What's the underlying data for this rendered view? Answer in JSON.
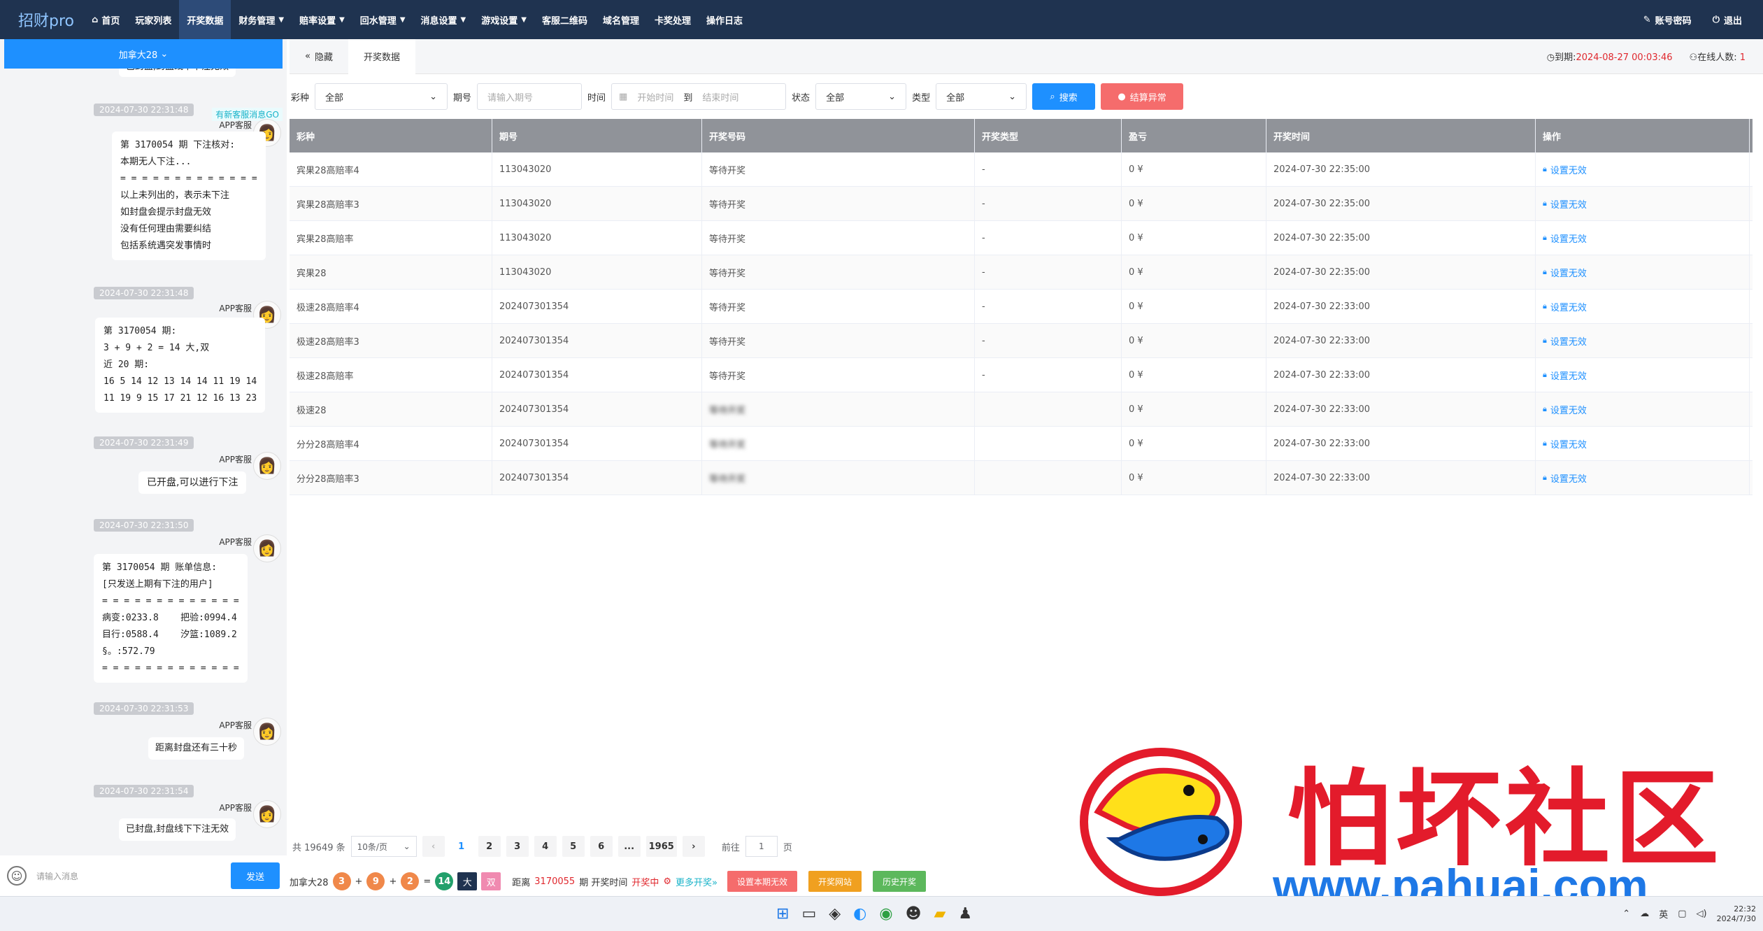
{
  "app": {
    "logo": "招财pro"
  },
  "nav": {
    "items": [
      {
        "label": "首页",
        "icon": "home-icon"
      },
      {
        "label": "玩家列表"
      },
      {
        "label": "开奖数据",
        "active": true
      },
      {
        "label": "财务管理",
        "dropdown": true
      },
      {
        "label": "赔率设置",
        "dropdown": true
      },
      {
        "label": "回水管理",
        "dropdown": true
      },
      {
        "label": "消息设置",
        "dropdown": true
      },
      {
        "label": "游戏设置",
        "dropdown": true
      },
      {
        "label": "客服二维码"
      },
      {
        "label": "域名管理"
      },
      {
        "label": "卡奖处理"
      },
      {
        "label": "操作日志"
      }
    ],
    "account_password": "账号密码",
    "logout": "退出"
  },
  "chat": {
    "header": "加拿大28",
    "top_partial": "已封盘,封盘线下下注无效",
    "notice": "有新客服消息GO",
    "messages": [
      {
        "time": "2024-07-30 22:31:48",
        "sender": "APP客服",
        "text": "第 3170054 期 下注核对:\n本期无人下注...\n= = = = = = = = = = = = =\n以上未列出的，表示未下注\n如封盘会提示封盘无效\n没有任何理由需要纠结\n包括系统遇突发事情时"
      },
      {
        "time": "2024-07-30 22:31:48",
        "sender": "APP客服",
        "text": "第 3170054 期:\n3 + 9 + 2 = 14 大,双\n近 20 期:\n16 5 14 12 13 14 14 11 19 14\n11 19 9 15 17 21 12 16 13 23"
      },
      {
        "time": "2024-07-30 22:31:49",
        "sender": "APP客服",
        "text": "已开盘,可以进行下注"
      },
      {
        "time": "2024-07-30 22:31:50",
        "sender": "APP客服",
        "text": "第 3170054 期 账单信息:\n[只发送上期有下注的用户]\n= = = = = = = = = = = = =\n病变:0233.8    把验:0994.4\n目行:0588.4    汐篮:1089.2\n§。:572.79\n= = = = = = = = = = = = ="
      },
      {
        "time": "2024-07-30 22:31:53",
        "sender": "APP客服",
        "text": "距离封盘还有三十秒"
      },
      {
        "time": "2024-07-30 22:31:54",
        "sender": "APP客服",
        "text": "已封盘,封盘线下下注无效"
      }
    ],
    "input_placeholder": "请输入消息",
    "send": "发送"
  },
  "tabs": {
    "hide": "隐藏",
    "current": "开奖数据"
  },
  "info": {
    "expiry_label": "到期:",
    "expiry_value": "2024-08-27 00:03:46",
    "online_label": "在线人数:",
    "online_value": "1"
  },
  "filter": {
    "lottery_label": "彩种",
    "lottery_value": "全部",
    "period_label": "期号",
    "period_placeholder": "请输入期号",
    "time_label": "时间",
    "start_placeholder": "开始时间",
    "to": "到",
    "end_placeholder": "结束时间",
    "status_label": "状态",
    "status_value": "全部",
    "type_label": "类型",
    "type_value": "全部",
    "search": "搜索",
    "settle": "结算异常"
  },
  "table": {
    "columns": [
      "彩种",
      "期号",
      "开奖号码",
      "开奖类型",
      "盈亏",
      "开奖时间",
      "操作"
    ],
    "rows": [
      [
        "宾果28高赔率4",
        "113043020",
        "等待开奖",
        "-",
        "0 ¥",
        "2024-07-30 22:35:00",
        "设置无效"
      ],
      [
        "宾果28高赔率3",
        "113043020",
        "等待开奖",
        "-",
        "0 ¥",
        "2024-07-30 22:35:00",
        "设置无效"
      ],
      [
        "宾果28高赔率",
        "113043020",
        "等待开奖",
        "-",
        "0 ¥",
        "2024-07-30 22:35:00",
        "设置无效"
      ],
      [
        "宾果28",
        "113043020",
        "等待开奖",
        "-",
        "0 ¥",
        "2024-07-30 22:35:00",
        "设置无效"
      ],
      [
        "极速28高赔率4",
        "202407301354",
        "等待开奖",
        "-",
        "0 ¥",
        "2024-07-30 22:33:00",
        "设置无效"
      ],
      [
        "极速28高赔率3",
        "202407301354",
        "等待开奖",
        "-",
        "0 ¥",
        "2024-07-30 22:33:00",
        "设置无效"
      ],
      [
        "极速28高赔率",
        "202407301354",
        "等待开奖",
        "-",
        "0 ¥",
        "2024-07-30 22:33:00",
        "设置无效"
      ],
      [
        "极速28",
        "202407301354",
        "等待开奖",
        "",
        "0 ¥",
        "2024-07-30 22:33:00",
        "设置无效"
      ],
      [
        "分分28高赔率4",
        "202407301354",
        "等待开奖",
        "",
        "0 ¥",
        "2024-07-30 22:33:00",
        "设置无效"
      ],
      [
        "分分28高赔率3",
        "202407301354",
        "等待开奖",
        "",
        "0 ¥",
        "2024-07-30 22:33:00",
        "设置无效"
      ]
    ],
    "blurred_rows_from": 7
  },
  "pager": {
    "total": "共 19649 条",
    "size": "10条/页",
    "pages": [
      "1",
      "2",
      "3",
      "4",
      "5",
      "6",
      "...",
      "1965"
    ],
    "current": "1",
    "goto_label": "前往",
    "goto_value": "1",
    "page_suffix": "页"
  },
  "status": {
    "game": "加拿大28",
    "balls": [
      "3",
      "9",
      "2"
    ],
    "sum": "14",
    "size": "大",
    "parity": "双",
    "distance": "距离",
    "period": "3170055",
    "period_text": "期 开奖时间",
    "state": "开奖中",
    "more": "更多开奖",
    "btn_invalid": "设置本期无效",
    "btn_site": "开奖网站",
    "btn_history": "历史开奖"
  },
  "taskbar": {
    "lang": "英",
    "time": "22:32",
    "date": "2024/7/30"
  },
  "watermark": {
    "title": "怕坏社区",
    "url": "www.pahuai.com"
  }
}
